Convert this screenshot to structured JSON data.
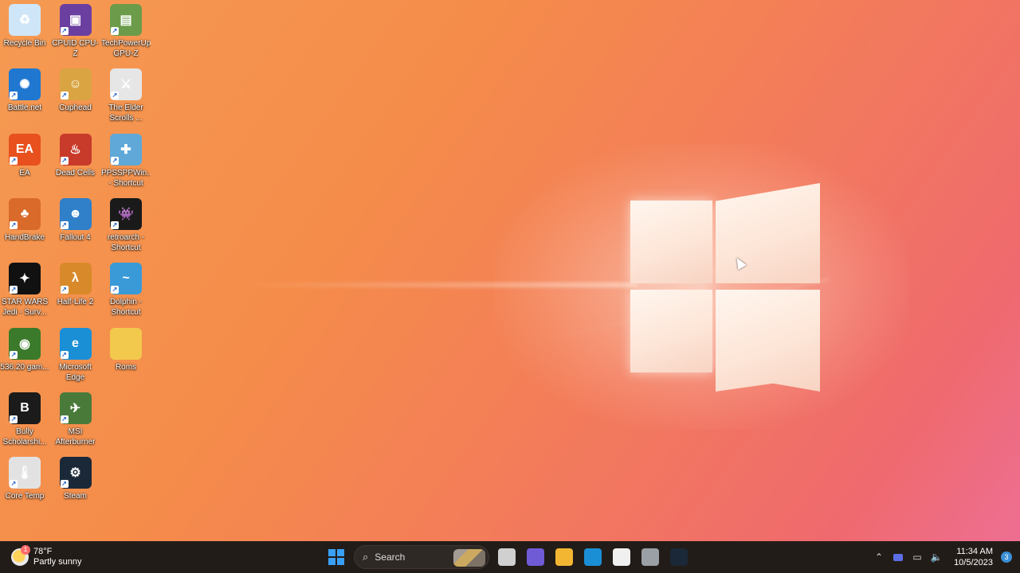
{
  "desktop": {
    "icons": [
      {
        "label": "Recycle Bin",
        "icon": "recycle-bin-icon",
        "color": "#cfe6f8",
        "glyph": "♻"
      },
      {
        "label": "CPUID CPU-Z",
        "icon": "cpu-z-icon",
        "color": "#6b3fa0",
        "glyph": "▣"
      },
      {
        "label": "TechPowerUp GPU-Z",
        "icon": "gpu-z-icon",
        "color": "#6c9c4a",
        "glyph": "▤"
      },
      {
        "label": "Battle.net",
        "icon": "battlenet-icon",
        "color": "#1f77d0",
        "glyph": "✺"
      },
      {
        "label": "Cuphead",
        "icon": "cuphead-icon",
        "color": "#d9a441",
        "glyph": "☺"
      },
      {
        "label": "The Elder Scrolls ...",
        "icon": "elder-scrolls-icon",
        "color": "#e6e6e6",
        "glyph": "⚔"
      },
      {
        "label": "EA",
        "icon": "ea-icon",
        "color": "#e8501e",
        "glyph": "EA"
      },
      {
        "label": "Dead Cells",
        "icon": "dead-cells-icon",
        "color": "#c83a2a",
        "glyph": "♨"
      },
      {
        "label": "PPSSPPWin... - Shortcut",
        "icon": "ppsspp-icon",
        "color": "#5fa8d8",
        "glyph": "✚"
      },
      {
        "label": "HandBrake",
        "icon": "handbrake-icon",
        "color": "#d96a2a",
        "glyph": "♣"
      },
      {
        "label": "Fallout 4",
        "icon": "fallout-icon",
        "color": "#2f7fc9",
        "glyph": "☻"
      },
      {
        "label": "retroarch - Shortcut",
        "icon": "retroarch-icon",
        "color": "#1a1a1a",
        "glyph": "👾"
      },
      {
        "label": "STAR WARS Jedi - Surv...",
        "icon": "star-wars-icon",
        "color": "#111111",
        "glyph": "✦"
      },
      {
        "label": "Half-Life 2",
        "icon": "half-life-icon",
        "color": "#d88a2a",
        "glyph": "λ"
      },
      {
        "label": "Dolphin - Shortcut",
        "icon": "dolphin-icon",
        "color": "#3a9ad8",
        "glyph": "~"
      },
      {
        "label": "536.20 gam...",
        "icon": "nvidia-icon",
        "color": "#3a7a2a",
        "glyph": "◉"
      },
      {
        "label": "Microsoft Edge",
        "icon": "edge-icon",
        "color": "#1b8fd6",
        "glyph": "e"
      },
      {
        "label": "Roms",
        "icon": "folder-icon",
        "color": "#f2c94c",
        "glyph": ""
      },
      {
        "label": "Bully Scholarshi...",
        "icon": "bully-icon",
        "color": "#1b1b1b",
        "glyph": "B"
      },
      {
        "label": "MSI Afterburner",
        "icon": "msi-afterburner-icon",
        "color": "#4a7a3a",
        "glyph": "✈"
      },
      {
        "label": "Core Temp",
        "icon": "core-temp-icon",
        "color": "#e2e2e2",
        "glyph": "🌡"
      },
      {
        "label": "Steam",
        "icon": "steam-icon",
        "color": "#1b2838",
        "glyph": "⚙"
      }
    ]
  },
  "taskbar": {
    "weather": {
      "temp": "78°F",
      "desc": "Partly sunny",
      "badge": "1"
    },
    "search_label": "Search",
    "apps": [
      {
        "name": "task-view",
        "color": "#d0d0d0"
      },
      {
        "name": "teams-chat",
        "color": "#6f5bd6"
      },
      {
        "name": "file-explorer",
        "color": "#f2b632"
      },
      {
        "name": "edge",
        "color": "#1b8fd6"
      },
      {
        "name": "store",
        "color": "#f0f0f0"
      },
      {
        "name": "settings",
        "color": "#9aa0a6"
      },
      {
        "name": "steam",
        "color": "#1b2838"
      }
    ],
    "time": "11:34 AM",
    "date": "10/5/2023",
    "notifications": "3"
  }
}
